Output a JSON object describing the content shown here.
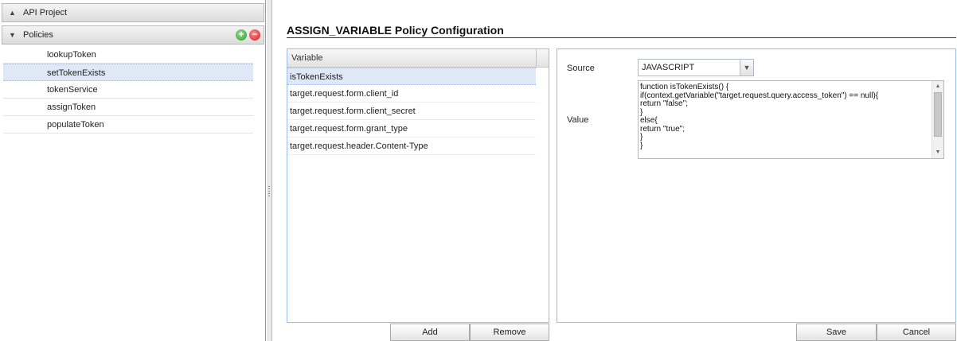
{
  "sidebar": {
    "project_header": "API Project",
    "policies_header": "Policies",
    "add_symbol": "+",
    "remove_symbol": "−",
    "policies": [
      "lookupToken",
      "setTokenExists",
      "tokenService",
      "assignToken",
      "populateToken"
    ],
    "selected_index": 1
  },
  "main": {
    "title": "ASSIGN_VARIABLE Policy Configuration",
    "variable_grid": {
      "column_header": "Variable",
      "rows": [
        "isTokenExists",
        "target.request.form.client_id",
        "target.request.form.client_secret",
        "target.request.form.grant_type",
        "target.request.header.Content-Type"
      ],
      "selected_index": 0
    },
    "buttons": {
      "add": "Add",
      "remove": "Remove",
      "save": "Save",
      "cancel": "Cancel"
    },
    "config": {
      "source_label": "Source",
      "source_value": "JAVASCRIPT",
      "value_label": "Value",
      "value_code": "function isTokenExists() {\nif(context.getVariable(\"target.request.query.access_token\") == null){\nreturn \"false\";\n}\nelse{\nreturn \"true\";\n}\n}"
    }
  },
  "colors": {
    "selection": "#dfe8f6",
    "panel_border": "#99bbe8",
    "add_icon": "#2e9a2e",
    "remove_icon": "#d02020"
  },
  "icons": {
    "project_chevron": "chevron-up-icon",
    "policies_chevron": "chevron-down-icon",
    "add": "add-circle-icon",
    "remove": "remove-circle-icon",
    "dropdown": "chevron-down-icon"
  }
}
